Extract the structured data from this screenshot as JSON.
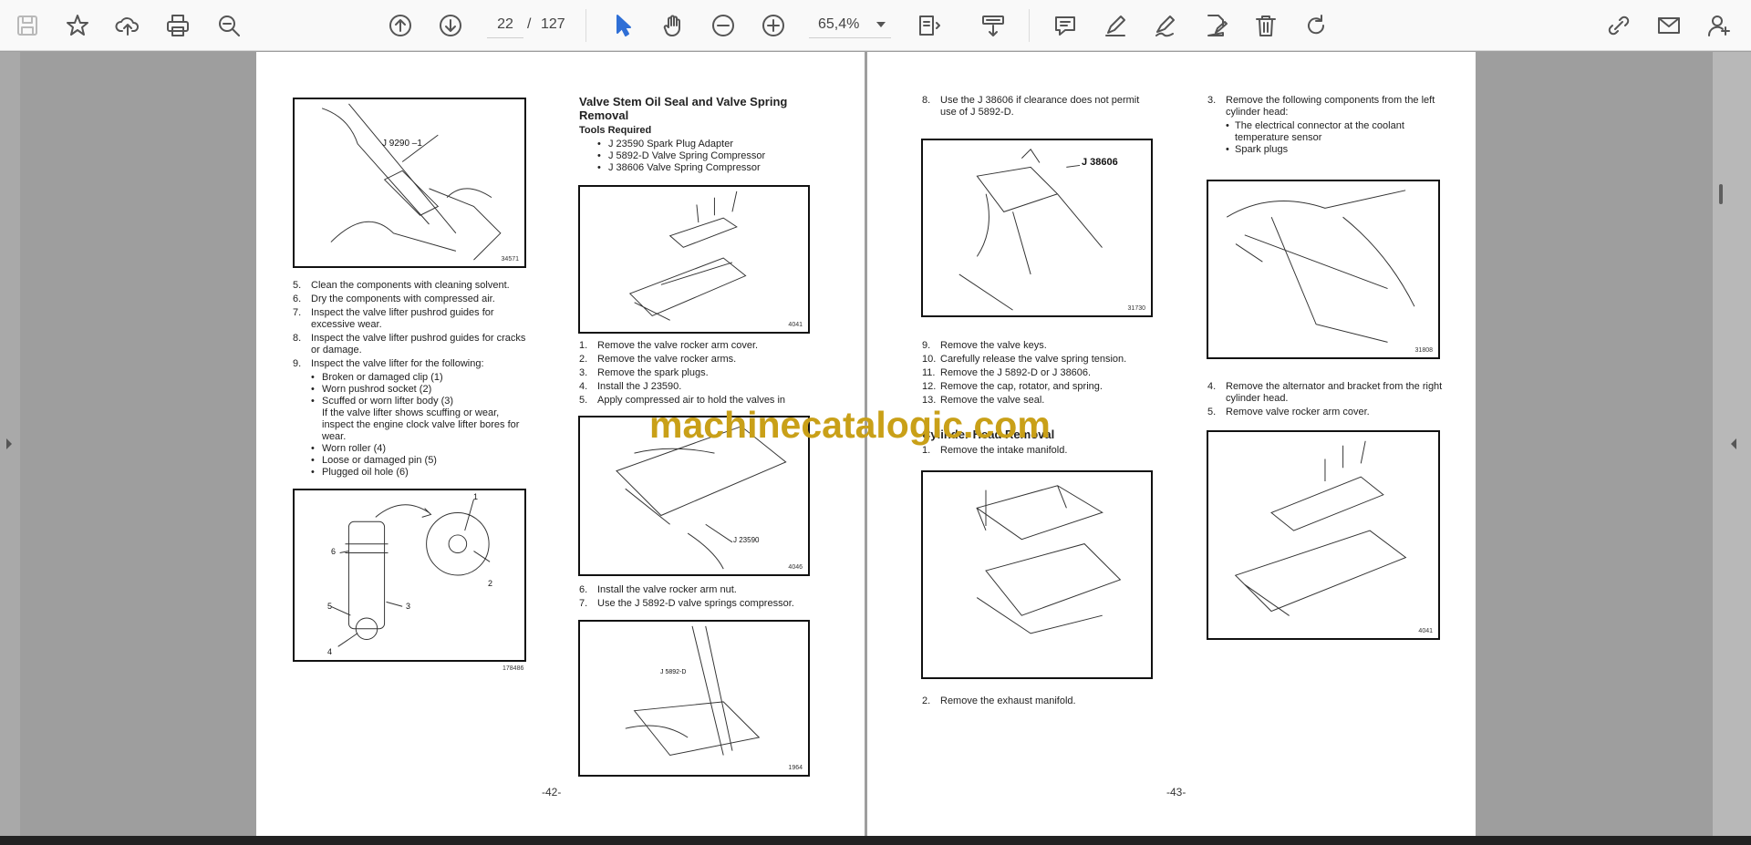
{
  "toolbar": {
    "page_current": "22",
    "page_separator": "/",
    "page_total": "127",
    "zoom": "65,4%"
  },
  "left_page": {
    "fig1": {
      "label": "J 9290 –1",
      "num": "34571"
    },
    "list1": [
      {
        "n": "5.",
        "t": "Clean the components with cleaning solvent."
      },
      {
        "n": "6.",
        "t": "Dry the components with compressed air."
      },
      {
        "n": "7.",
        "t": "Inspect the valve lifter pushrod guides for excessive wear."
      },
      {
        "n": "8.",
        "t": "Inspect the valve lifter pushrod guides for cracks or damage."
      },
      {
        "n": "9.",
        "t": "Inspect the valve lifter for the following:"
      }
    ],
    "bullets1": [
      "Broken or damaged clip (1)",
      "Worn pushrod socket (2)",
      "Scuffed or worn lifter body (3)"
    ],
    "bullets1_note": "If the valve lifter shows scuffing or wear, inspect the engine clock valve lifter bores for wear.",
    "bullets2": [
      "Worn roller (4)",
      "Loose or damaged pin (5)",
      "Plugged oil hole (6)"
    ],
    "fig2": {
      "num": "178486",
      "c1": "1",
      "c2": "2",
      "c3": "3",
      "c4": "4",
      "c5": "5",
      "c6": "6"
    },
    "heading": "Valve Stem Oil Seal and Valve Spring Removal",
    "tools_heading": "Tools Required",
    "tools": [
      "J 23590 Spark Plug Adapter",
      "J 5892-D Valve Spring Compressor",
      "J 38606 Valve Spring Compressor"
    ],
    "fig3": {
      "num": "4041"
    },
    "list2": [
      {
        "n": "1.",
        "t": "Remove the valve rocker arm cover."
      },
      {
        "n": "2.",
        "t": "Remove the valve rocker arms."
      },
      {
        "n": "3.",
        "t": "Remove the spark plugs."
      },
      {
        "n": "4.",
        "t": "Install the J 23590."
      },
      {
        "n": "5.",
        "t": "Apply compressed air to hold the valves in"
      }
    ],
    "fig4": {
      "label": "J 23590",
      "num": "4046"
    },
    "list3": [
      {
        "n": "6.",
        "t": "Install the valve rocker arm nut."
      },
      {
        "n": "7.",
        "t": "Use the J 5892-D valve springs compressor."
      }
    ],
    "fig5": {
      "label": "J 5892-D",
      "num": "1964"
    },
    "page_number": "-42-"
  },
  "right_page": {
    "list1": [
      {
        "n": "8.",
        "t": "Use the J 38606 if clearance does not permit use of J 5892-D."
      }
    ],
    "fig1": {
      "label": "J 38606",
      "num": "31730"
    },
    "list2": [
      {
        "n": "9.",
        "t": "Remove the valve keys."
      },
      {
        "n": "10.",
        "t": "Carefully release the valve spring tension."
      },
      {
        "n": "11.",
        "t": "Remove the J 5892-D or J 38606."
      },
      {
        "n": "12.",
        "t": "Remove the cap, rotator, and spring."
      },
      {
        "n": "13.",
        "t": "Remove the valve seal."
      }
    ],
    "heading": "Cylinder Head Removal",
    "list3": [
      {
        "n": "1.",
        "t": "Remove the intake manifold."
      }
    ],
    "list4": [
      {
        "n": "2.",
        "t": "Remove the exhaust manifold."
      }
    ],
    "list5": [
      {
        "n": "3.",
        "t": "Remove the following components from the left cylinder head:"
      }
    ],
    "bullets": [
      "The electrical connector at the coolant temperature sensor",
      "Spark plugs"
    ],
    "fig3": {
      "num": "31808"
    },
    "list6": [
      {
        "n": "4.",
        "t": "Remove the alternator and bracket from the right cylinder head."
      },
      {
        "n": "5.",
        "t": "Remove valve rocker arm cover."
      }
    ],
    "fig4": {
      "num": "4041"
    },
    "page_number": "-43-"
  },
  "watermark": "machinecatalogic.com",
  "colors": {
    "toolbar_bg": "#f9f9f9",
    "viewer_bg": "#9e9e9e",
    "accent": "#2f6fd6",
    "watermark": "#c9a018"
  }
}
